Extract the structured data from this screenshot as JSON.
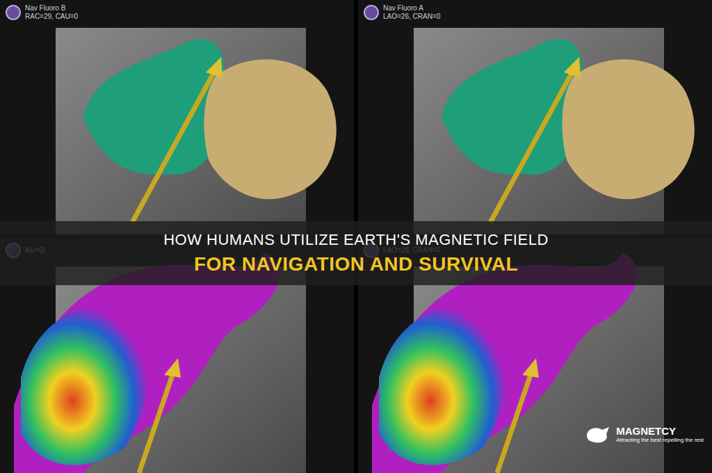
{
  "panels": [
    {
      "labels": [
        "Nav Fluoro B",
        "RAC=29, CAU=0"
      ],
      "kind": "anatomy"
    },
    {
      "labels": [
        "Nav Fluoro A",
        "LAO=26, CRAN=0"
      ],
      "kind": "anatomy"
    },
    {
      "labels": [
        "AU=0)"
      ],
      "kind": "voltage-map"
    },
    {
      "labels": [
        "LAO=26, CRAN=0"
      ],
      "kind": "voltage-map"
    }
  ],
  "headline": {
    "line1": "HOW HUMANS UTILIZE EARTH'S MAGNETIC FIELD",
    "line2": "FOR NAVIGATION AND SURVIVAL"
  },
  "logo": {
    "name": "MAGNETCY",
    "tagline": "Attracting the best repelling the rest"
  }
}
